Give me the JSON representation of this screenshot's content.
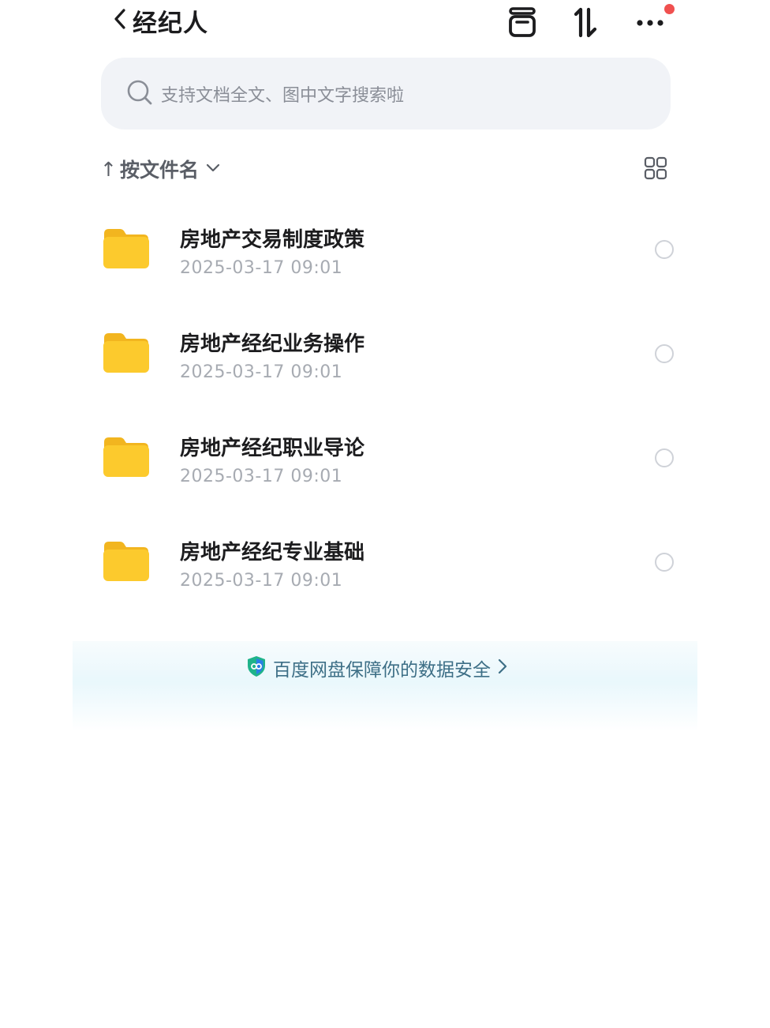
{
  "header": {
    "title": "经纪人",
    "icons": {
      "back": "chevron-left-icon",
      "transfer": "transfer-box-icon",
      "sort": "sort-arrows-icon",
      "more": "more-dots-icon"
    },
    "notification_dot_color": "#f0504f"
  },
  "search": {
    "placeholder": "支持文档全文、图中文字搜索啦"
  },
  "sortbar": {
    "arrow": "↑",
    "label": "按文件名"
  },
  "files": [
    {
      "name": "房地产交易制度政策",
      "date": "2025-03-17  09:01"
    },
    {
      "name": "房地产经纪业务操作",
      "date": "2025-03-17  09:01"
    },
    {
      "name": "房地产经纪职业导论",
      "date": "2025-03-17  09:01"
    },
    {
      "name": "房地产经纪专业基础",
      "date": "2025-03-17  09:01"
    }
  ],
  "banner": {
    "text": "百度网盘保障你的数据安全"
  },
  "colors": {
    "folder": "#fbc92b",
    "accent_text": "#3d6f86",
    "search_bg": "#f1f3f7"
  }
}
